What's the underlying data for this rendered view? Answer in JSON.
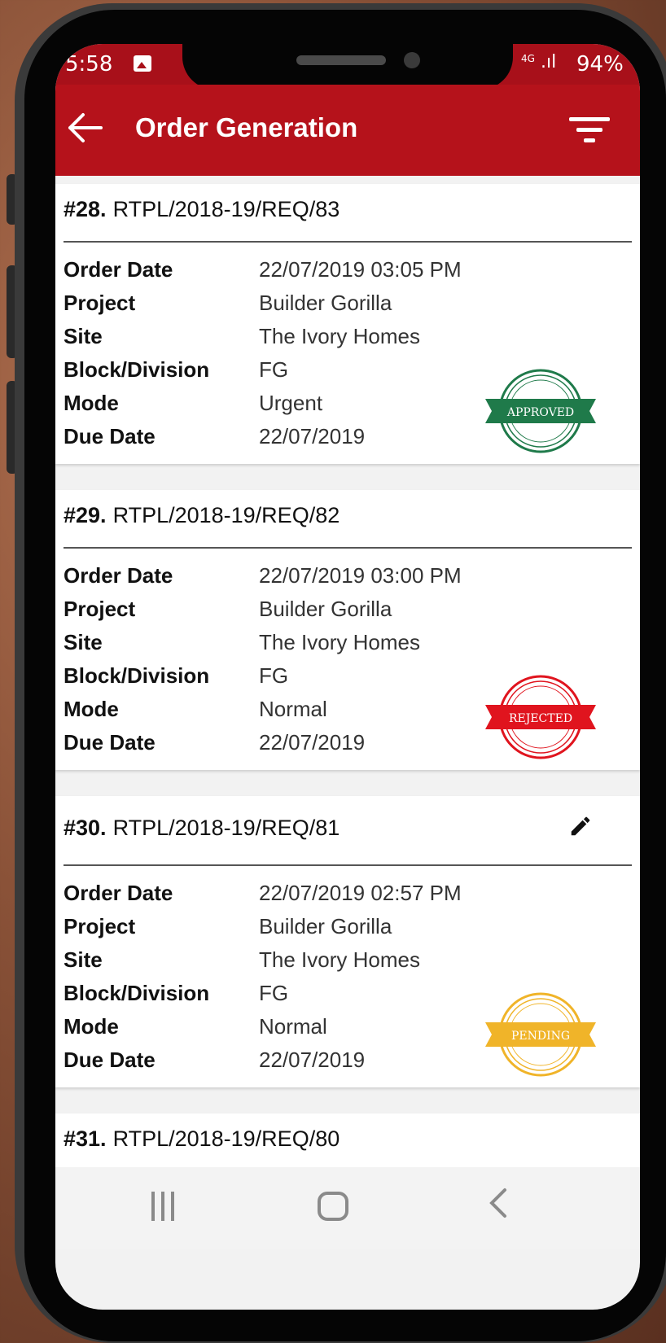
{
  "status": {
    "time": "5:58",
    "network": "4G",
    "battery": "94%"
  },
  "appbar": {
    "title": "Order Generation"
  },
  "orders": [
    {
      "num": "#28.",
      "ref": "RTPL/2018-19/REQ/83",
      "fields": [
        {
          "k": "Order Date",
          "v": "22/07/2019 03:05 PM"
        },
        {
          "k": "Project",
          "v": "Builder Gorilla"
        },
        {
          "k": "Site",
          "v": "The Ivory Homes"
        },
        {
          "k": "Block/Division",
          "v": "FG"
        },
        {
          "k": "Mode",
          "v": "Urgent"
        },
        {
          "k": "Due Date",
          "v": "22/07/2019"
        }
      ],
      "stamp": "APPROVED",
      "stamp_color": "#1f7a4a"
    },
    {
      "num": "#29.",
      "ref": "RTPL/2018-19/REQ/82",
      "fields": [
        {
          "k": "Order Date",
          "v": "22/07/2019 03:00 PM"
        },
        {
          "k": "Project",
          "v": "Builder Gorilla"
        },
        {
          "k": "Site",
          "v": "The Ivory Homes"
        },
        {
          "k": "Block/Division",
          "v": "FG"
        },
        {
          "k": "Mode",
          "v": "Normal"
        },
        {
          "k": "Due Date",
          "v": "22/07/2019"
        }
      ],
      "stamp": "REJECTED",
      "stamp_color": "#e0141e"
    },
    {
      "num": "#30.",
      "ref": "RTPL/2018-19/REQ/81",
      "fields": [
        {
          "k": "Order Date",
          "v": "22/07/2019 02:57 PM"
        },
        {
          "k": "Project",
          "v": "Builder Gorilla"
        },
        {
          "k": "Site",
          "v": "The Ivory Homes"
        },
        {
          "k": "Block/Division",
          "v": "FG"
        },
        {
          "k": "Mode",
          "v": "Normal"
        },
        {
          "k": "Due Date",
          "v": "22/07/2019"
        }
      ],
      "stamp": "PENDING",
      "stamp_color": "#f0b429",
      "editable": true
    },
    {
      "num": "#31.",
      "ref": "RTPL/2018-19/REQ/80",
      "fields": []
    }
  ],
  "colors": {
    "appbar": "#b5121b",
    "statusbar": "#a8101a"
  }
}
